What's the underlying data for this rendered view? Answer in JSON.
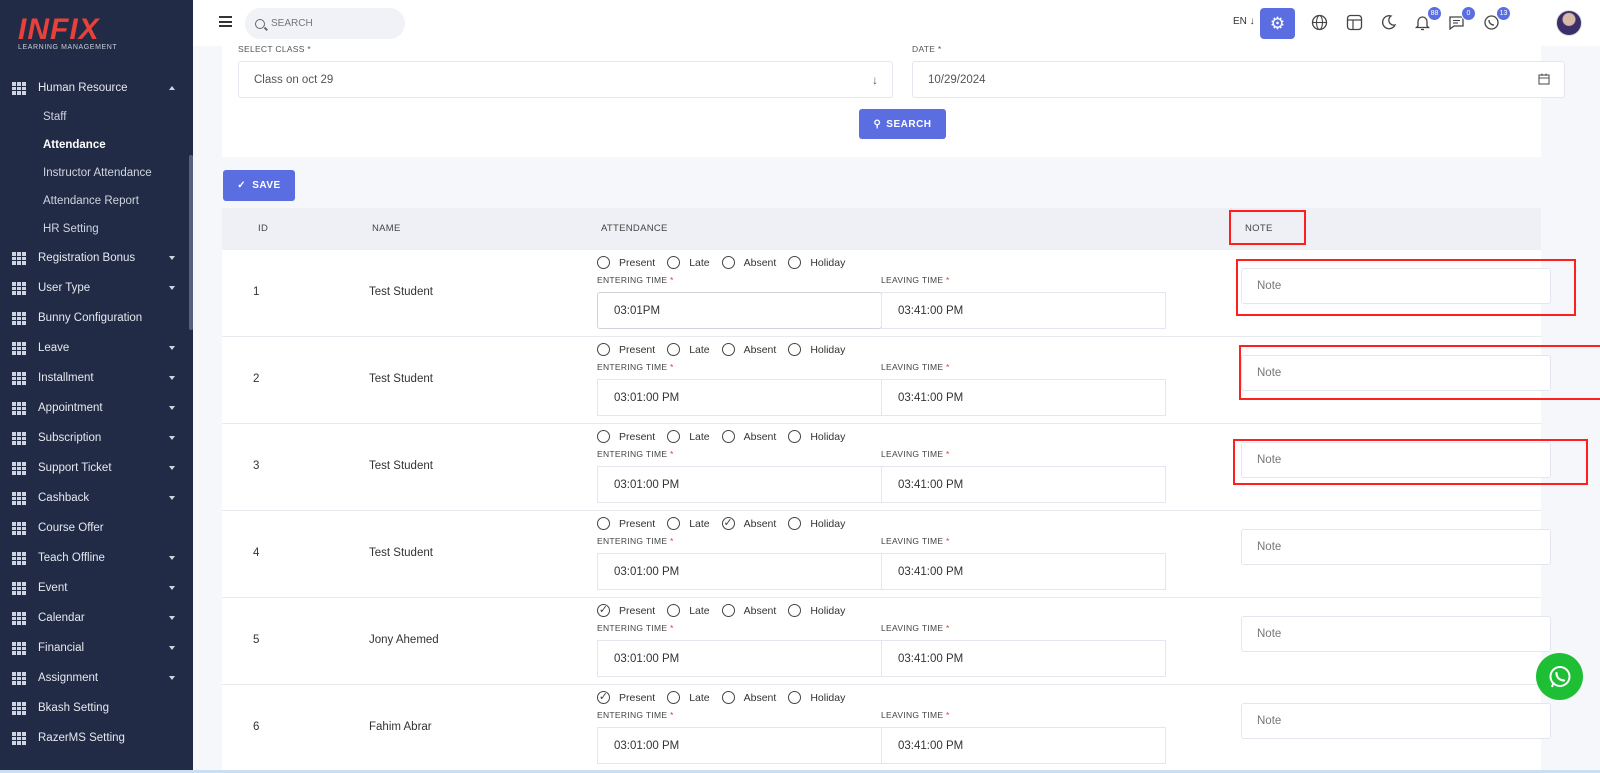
{
  "sidebar": {
    "logo": {
      "brand": "INFIX",
      "tagline": "LEARNING MANAGEMENT"
    },
    "group": {
      "label": "Human Resource"
    },
    "sub_items": [
      {
        "label": "Staff"
      },
      {
        "label": "Attendance"
      },
      {
        "label": "Instructor Attendance"
      },
      {
        "label": "Attendance Report"
      },
      {
        "label": "HR Setting"
      }
    ],
    "items": [
      {
        "label": "Registration Bonus",
        "caret": true
      },
      {
        "label": "User Type",
        "caret": true
      },
      {
        "label": "Bunny Configuration",
        "caret": false
      },
      {
        "label": "Leave",
        "caret": true
      },
      {
        "label": "Installment",
        "caret": true
      },
      {
        "label": "Appointment",
        "caret": true
      },
      {
        "label": "Subscription",
        "caret": true
      },
      {
        "label": "Support Ticket",
        "caret": true
      },
      {
        "label": "Cashback",
        "caret": true
      },
      {
        "label": "Course Offer",
        "caret": false
      },
      {
        "label": "Teach Offline",
        "caret": true
      },
      {
        "label": "Event",
        "caret": true
      },
      {
        "label": "Calendar",
        "caret": true
      },
      {
        "label": "Financial",
        "caret": true
      },
      {
        "label": "Assignment",
        "caret": true
      },
      {
        "label": "Bkash Setting",
        "caret": false
      },
      {
        "label": "RazerMS Setting",
        "caret": false
      }
    ]
  },
  "topbar": {
    "search_placeholder": "SEARCH",
    "lang": "EN ↓",
    "badges": {
      "notifications": "88",
      "messages": "0",
      "whatsapp": "13"
    }
  },
  "filter": {
    "class_label": "SELECT CLASS *",
    "class_value": "Class on oct 29",
    "date_label": "DATE *",
    "date_value": "10/29/2024",
    "search_button": "SEARCH"
  },
  "save_button": "SAVE",
  "table": {
    "headers": {
      "id": "ID",
      "name": "NAME",
      "attendance": "ATTENDANCE",
      "note": "NOTE"
    },
    "radio_labels": [
      "Present",
      "Late",
      "Absent",
      "Holiday"
    ],
    "entering_label": "ENTERING TIME",
    "leaving_label": "LEAVING TIME",
    "required_mark": "*",
    "note_placeholder": "Note",
    "rows": [
      {
        "id": "1",
        "name": "Test Student",
        "status": "",
        "entering": "03:01PM",
        "leaving": "03:41:00 PM"
      },
      {
        "id": "2",
        "name": "Test Student",
        "status": "",
        "entering": "03:01:00 PM",
        "leaving": "03:41:00 PM"
      },
      {
        "id": "3",
        "name": "Test Student",
        "status": "",
        "entering": "03:01:00 PM",
        "leaving": "03:41:00 PM"
      },
      {
        "id": "4",
        "name": "Test Student",
        "status": "Absent",
        "entering": "03:01:00 PM",
        "leaving": "03:41:00 PM"
      },
      {
        "id": "5",
        "name": "Jony Ahemed",
        "status": "Present",
        "entering": "03:01:00 PM",
        "leaving": "03:41:00 PM"
      },
      {
        "id": "6",
        "name": "Fahim Abrar",
        "status": "Present",
        "entering": "03:01:00 PM",
        "leaving": "03:41:00 PM"
      }
    ]
  },
  "colors": {
    "accent": "#5b6ee1",
    "sidebar": "#222b45",
    "highlight": "#ff1f1f",
    "whatsapp": "#1fbf35"
  }
}
